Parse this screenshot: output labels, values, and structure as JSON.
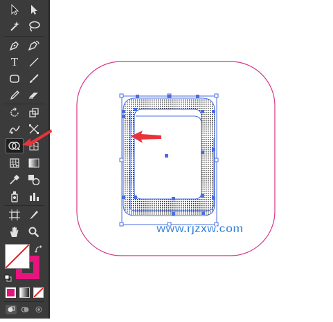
{
  "toolbar": {
    "active_tool": "shape-builder-tool",
    "text_tool_glyph": "T",
    "tools": [
      "selection-tool",
      "direct-selection-tool",
      "magic-wand-tool",
      "lasso-tool",
      "pen-tool",
      "curvature-tool",
      "type-tool",
      "line-segment-tool",
      "rectangle-tool",
      "paintbrush-tool",
      "pencil-tool",
      "eraser-tool",
      "rotate-tool",
      "scale-tool",
      "puppet-warp-tool",
      "free-transform-tool",
      "shape-builder-tool",
      "perspective-grid-tool",
      "mesh-tool",
      "gradient-tool",
      "eyedropper-tool",
      "blend-tool",
      "symbol-sprayer-tool",
      "column-graph-tool",
      "artboard-tool",
      "slice-tool",
      "hand-tool",
      "zoom-tool"
    ]
  },
  "colors": {
    "fill": "#ffffff",
    "stroke": "#e6147c",
    "none_slash": "#e02020",
    "swatch_color": "#e6147c",
    "outer_rounded_rect_stroke": "#d6338a",
    "selection_blue": "#4a6ee0",
    "arrow_red": "#e8333a",
    "watermark_color": "#2f7fd6"
  },
  "canvas": {
    "watermark": "www.rjzxw.com"
  }
}
